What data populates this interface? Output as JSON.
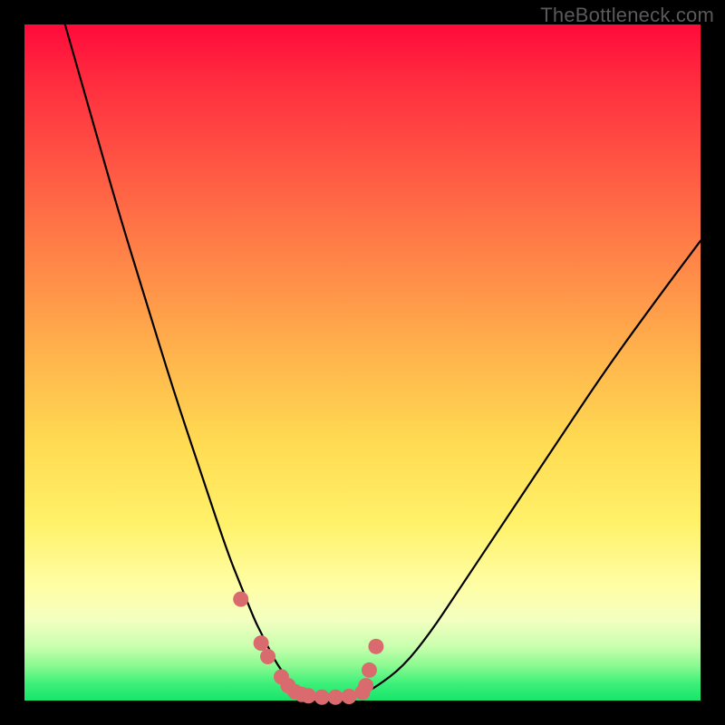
{
  "watermark": "TheBottleneck.com",
  "colors": {
    "frame": "#000000",
    "curve_stroke": "#000000",
    "marker_fill": "#d96b6e",
    "gradient_top": "#ff0a3a",
    "gradient_bottom": "#18e56b"
  },
  "chart_data": {
    "type": "line",
    "title": "",
    "xlabel": "",
    "ylabel": "",
    "xlim": [
      0,
      100
    ],
    "ylim": [
      0,
      100
    ],
    "x": [
      6,
      10,
      14,
      18,
      22,
      26,
      30,
      32,
      34,
      35,
      36,
      37,
      38,
      39,
      40,
      41,
      42,
      44,
      46,
      48,
      50,
      52,
      56,
      60,
      64,
      70,
      78,
      86,
      94,
      100
    ],
    "values": [
      100,
      86,
      72,
      59,
      46,
      34,
      22,
      17,
      12,
      10,
      8,
      6,
      4.5,
      3,
      2,
      1.2,
      0.8,
      0.5,
      0.5,
      0.6,
      1,
      2,
      5,
      10,
      16,
      25,
      37,
      49,
      60,
      68
    ],
    "markers": {
      "x": [
        32,
        35,
        36,
        38,
        39,
        40,
        41,
        42,
        44,
        46,
        48,
        50,
        50.5,
        51,
        52
      ],
      "y": [
        15,
        8.5,
        6.5,
        3.5,
        2.2,
        1.3,
        0.9,
        0.7,
        0.5,
        0.5,
        0.6,
        1.2,
        2.2,
        4.5,
        8
      ]
    }
  }
}
